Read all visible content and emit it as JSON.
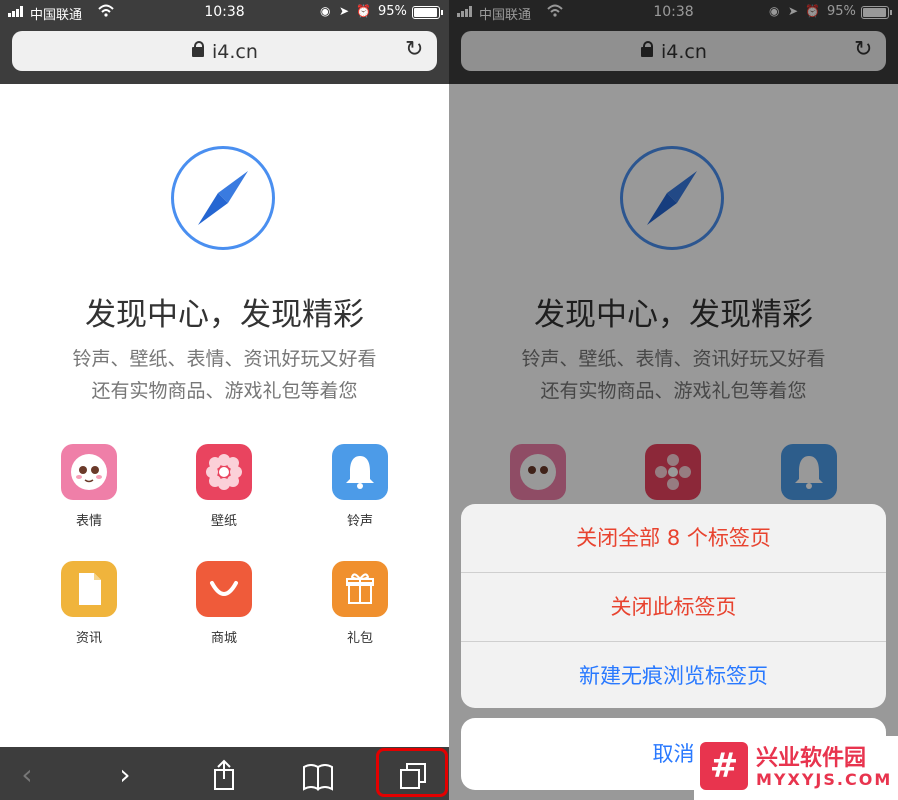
{
  "status_bar": {
    "carrier": "中国联通",
    "time": "10:38",
    "battery": "95%"
  },
  "url_bar": {
    "url": "i4.cn"
  },
  "page": {
    "headline": "发现中心，发现精彩",
    "subtitle_line1": "铃声、壁纸、表情、资讯好玩又好看",
    "subtitle_line2": "还有实物商品、游戏礼包等着您",
    "tiles": [
      {
        "label": "表情",
        "color": "#ef7fa8",
        "icon": "smiley-face-icon"
      },
      {
        "label": "壁纸",
        "color": "#e9445f",
        "icon": "flower-icon"
      },
      {
        "label": "铃声",
        "color": "#4c9be8",
        "icon": "bell-icon"
      },
      {
        "label": "资讯",
        "color": "#f0b43c",
        "icon": "document-icon"
      },
      {
        "label": "商城",
        "color": "#ef5b3a",
        "icon": "smile-bag-icon"
      },
      {
        "label": "礼包",
        "color": "#f0902e",
        "icon": "gift-icon"
      }
    ]
  },
  "action_sheet": {
    "close_all": "关闭全部 8 个标签页",
    "close_this": "关闭此标签页",
    "new_private": "新建无痕浏览标签页",
    "cancel": "取消",
    "destructive_color": "#e8432f",
    "default_color": "#2979ff"
  },
  "watermark": {
    "name": "兴业软件园",
    "url": "MYXYJS.COM",
    "logo_glyph": "#",
    "color": "#e8344e"
  }
}
